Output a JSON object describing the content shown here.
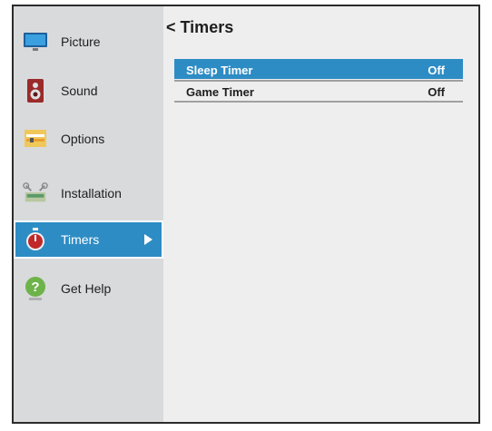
{
  "sidebar": {
    "items": [
      {
        "label": "Picture",
        "icon": "tv-icon"
      },
      {
        "label": "Sound",
        "icon": "speaker-icon"
      },
      {
        "label": "Options",
        "icon": "options-icon"
      },
      {
        "label": "Installation",
        "icon": "installation-icon"
      },
      {
        "label": "Timers",
        "icon": "stopwatch-icon",
        "selected": true
      },
      {
        "label": "Get Help",
        "icon": "help-icon"
      }
    ]
  },
  "main": {
    "title": "< Timers",
    "rows": [
      {
        "label": "Sleep Timer",
        "value": "Off",
        "selected": true
      },
      {
        "label": "Game Timer",
        "value": "Off",
        "selected": false
      }
    ]
  },
  "colors": {
    "accent": "#2e8cc4",
    "sidebar_bg": "#d9dadc",
    "content_bg": "#eeeeee"
  }
}
